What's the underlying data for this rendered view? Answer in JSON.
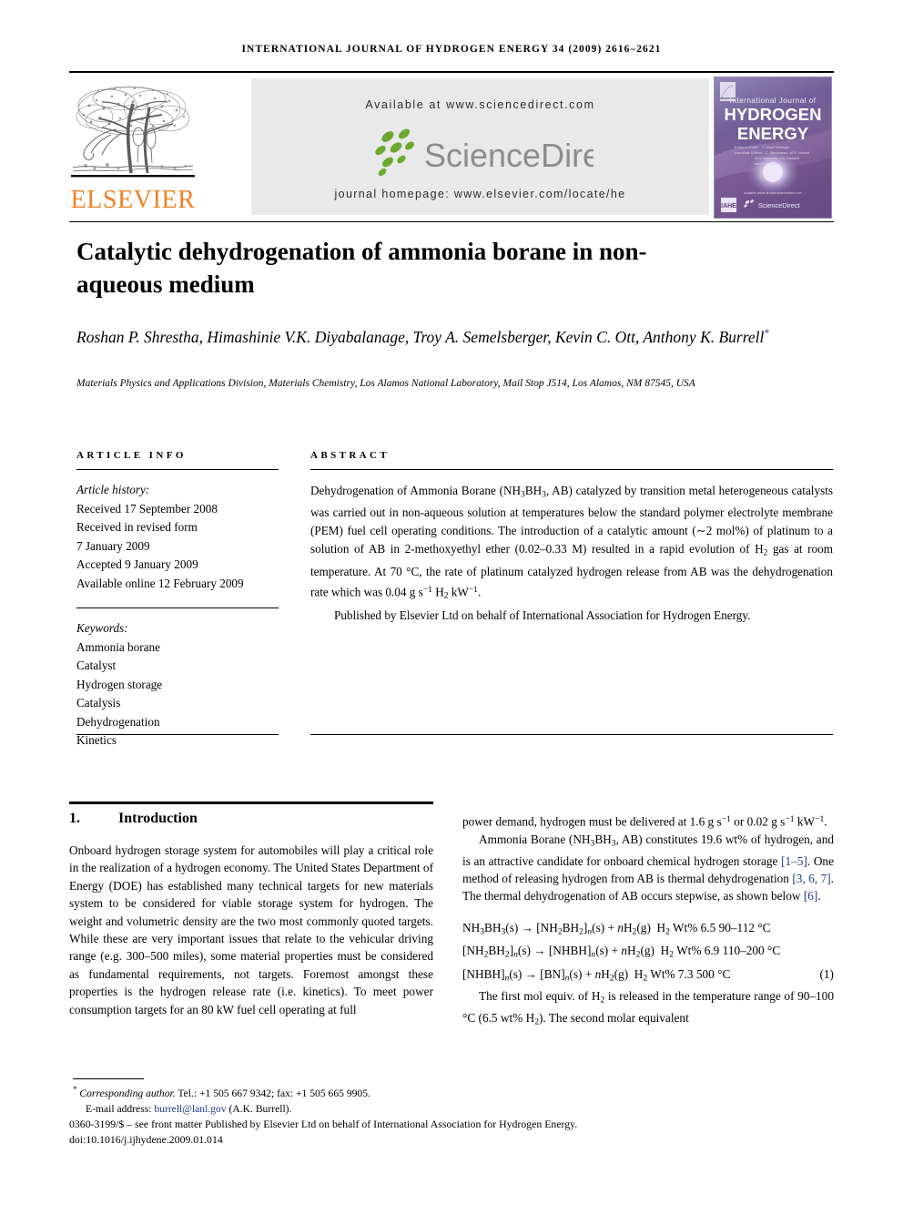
{
  "running_head": "INTERNATIONAL JOURNAL OF HYDROGEN ENERGY 34 (2009) 2616–2621",
  "header": {
    "publisher_logo_text": "ELSEVIER",
    "publisher_logo_color": "#F08122",
    "available_at": "Available at www.sciencedirect.com",
    "sciencedirect_wordmark": "ScienceDirect",
    "sciencedirect_text_color": "#8a8d8a",
    "sciencedirect_leaf_color": "#6aa830",
    "journal_homepage": "journal homepage: www.elsevier.com/locate/he",
    "band_background": "#e9e9e9",
    "cover": {
      "line1": "International Journal of",
      "line2": "HYDROGEN",
      "line3": "ENERGY",
      "editor_block": "Editor-in-Chief: T. Nejat Veziroglu   Associate Editors: C. Bieńkowski, M.R. Veszeli, W.A. Masseon, J.N. Huddart and E.A. Eggel",
      "footer_badge": "IAHE",
      "footer_brand": "ScienceDirect",
      "bg_top": "#8e7fb0",
      "bg_mid": "#6e5f9b",
      "bg_bottom": "#7a5b92"
    }
  },
  "article": {
    "title": "Catalytic dehydrogenation of ammonia borane in non-aqueous medium",
    "authors": "Roshan P. Shrestha, Himashinie V.K. Diyabalanage, Troy A. Semelsberger, Kevin C. Ott, Anthony K. Burrell",
    "corresponding_marker": "*",
    "affiliation": "Materials Physics and Applications Division, Materials Chemistry, Los Alamos National Laboratory, Mail Stop J514, Los Alamos, NM 87545, USA"
  },
  "article_info": {
    "heading": "ARTICLE INFO",
    "history_label": "Article history:",
    "history": [
      "Received 17 September 2008",
      "Received in revised form",
      "7 January 2009",
      "Accepted 9 January 2009",
      "Available online 12 February 2009"
    ],
    "keywords_label": "Keywords:",
    "keywords": [
      "Ammonia borane",
      "Catalyst",
      "Hydrogen storage",
      "Catalysis",
      "Dehydrogenation",
      "Kinetics"
    ]
  },
  "abstract": {
    "heading": "ABSTRACT",
    "body_html": "Dehydrogenation of Ammonia Borane (NH<sub>3</sub>BH<sub>3</sub>, AB) catalyzed by transition metal heterogeneous catalysts was carried out in non-aqueous solution at temperatures below the standard polymer electrolyte membrane (PEM) fuel cell operating conditions. The introduction of a catalytic amount (∼2 mol%) of platinum to a solution of AB in 2-methoxyethyl ether (0.02–0.33 M) resulted in a rapid evolution of H<sub>2</sub> gas at room temperature. At 70 °C, the rate of platinum catalyzed hydrogen release from AB was the dehydrogenation rate which was 0.04 g s<sup>−1</sup> H<sub>2</sub> kW<sup>−1</sup>.",
    "publisher_note": "Published by Elsevier Ltd on behalf of International Association for Hydrogen Energy."
  },
  "body": {
    "section_number": "1.",
    "section_title": "Introduction",
    "left_paragraph_1": "Onboard hydrogen storage system for automobiles will play a critical role in the realization of a hydrogen economy. The United States Department of Energy (DOE) has established many technical targets for new materials system to be considered for viable storage system for hydrogen. The weight and volumetric density are the two most commonly quoted targets. While these are very important issues that relate to the vehicular driving range (e.g. 300–500 miles), some material properties must be considered as fundamental requirements, not targets. Foremost amongst these properties is the hydrogen release rate (i.e. kinetics). To meet power consumption targets for an 80 kW fuel cell operating at full",
    "right_paragraph_1_html": "power demand, hydrogen must be delivered at 1.6 g s<sup>−1</sup> or 0.02 g s<sup>−1</sup> kW<sup>−1</sup>.",
    "right_paragraph_2_html": "Ammonia Borane (NH<sub>3</sub>BH<sub>3</sub>, AB) constitutes 19.6 wt% of hydrogen, and is an attractive candidate for onboard chemical hydrogen storage [1–5]. One method of releasing hydrogen from AB is thermal dehydrogenation [3, 6, 7]. The thermal dehydrogenation of AB occurs stepwise, as shown below [6].",
    "equation_lines_html": [
      "NH<sub>3</sub>BH<sub>3</sub>(s) → [NH<sub>2</sub>BH<sub>2</sub>]<sub><i>n</i></sub>(s) + <i>n</i>H<sub>2</sub>(g)&nbsp; H<sub>2</sub> Wt% 6.5 90–112 °C",
      "[NH<sub>2</sub>BH<sub>2</sub>]<sub><i>n</i></sub>(s) → [NHBH]<sub><i>n</i></sub>(s) + <i>n</i>H<sub>2</sub>(g)&nbsp; H<sub>2</sub> Wt% 6.9 110–200 °C",
      "[NHBH]<sub><i>n</i></sub>(s) → [BN]<sub><i>n</i></sub>(s) + <i>n</i>H<sub>2</sub>(g)&nbsp; H<sub>2</sub> Wt% 7.3 500 °C"
    ],
    "equation_number": "(1)",
    "right_paragraph_3_html": "The first mol equiv. of H<sub>2</sub> is released in the temperature range of 90–100 °C (6.5 wt% H<sub>2</sub>). The second molar equivalent",
    "citations": [
      "1–5",
      "3, 6, 7",
      "6"
    ],
    "citation_color": "#1b3a8c"
  },
  "footer": {
    "corresponding_marker": "*",
    "corresponding_label": "Corresponding author.",
    "corresponding_contact": " Tel.: +1 505 667 9342; fax: +1 505 665 9905.",
    "email_label": "E-mail address:",
    "email": "burrell@lanl.gov",
    "email_suffix": " (A.K. Burrell).",
    "imprint": "0360-3199/$ – see front matter Published by Elsevier Ltd on behalf of International Association for Hydrogen Energy.",
    "doi": "doi:10.1016/j.ijhydene.2009.01.014"
  }
}
